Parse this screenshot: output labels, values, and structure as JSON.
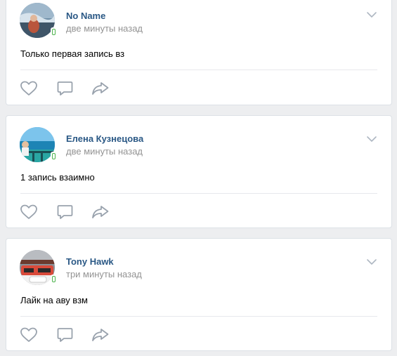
{
  "posts": [
    {
      "author": "No Name",
      "time": "две минуты назад",
      "text": "Только первая запись вз",
      "avatar": "avatar-photo"
    },
    {
      "author": "Елена Кузнецова",
      "time": "две минуты назад",
      "text": "1 запись взаимно",
      "avatar": "avatar-photo"
    },
    {
      "author": "Tony Hawk",
      "time": "три минуты назад",
      "text": "Лайк на аву взм",
      "avatar": "avatar-photo"
    }
  ],
  "icons": {
    "like": "heart-icon",
    "comment": "comment-icon",
    "share": "share-icon",
    "menu": "chevron-down-icon",
    "online": "mobile-online-icon"
  },
  "colors": {
    "author": "#2a5885",
    "meta": "#939393",
    "action_icon": "#99a2ad",
    "online": "#4bb34b"
  }
}
